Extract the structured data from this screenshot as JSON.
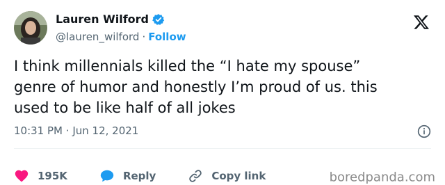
{
  "user": {
    "name": "Lauren Wilford",
    "handle": "@lauren_wilford",
    "separator": "·",
    "follow_label": "Follow"
  },
  "tweet": {
    "text": "I think millennials killed the “I hate my spouse”\ngenre of humor and honestly I’m proud of us. this\nused to be like half of all jokes",
    "time": "10:31 PM",
    "time_separator": "·",
    "date": "Jun 12, 2021"
  },
  "actions": {
    "likes": "195K",
    "reply_label": "Reply",
    "copy_label": "Copy link"
  },
  "watermark": "boredpanda.com",
  "colors": {
    "accent": "#1d9bf0",
    "like": "#f91880",
    "muted": "#536471",
    "text": "#0f1419"
  },
  "icons": {
    "verified": "verified-badge-icon",
    "logo": "x-logo-icon",
    "info": "info-icon",
    "like": "heart-icon",
    "reply": "speech-bubble-icon",
    "copy": "link-icon"
  }
}
